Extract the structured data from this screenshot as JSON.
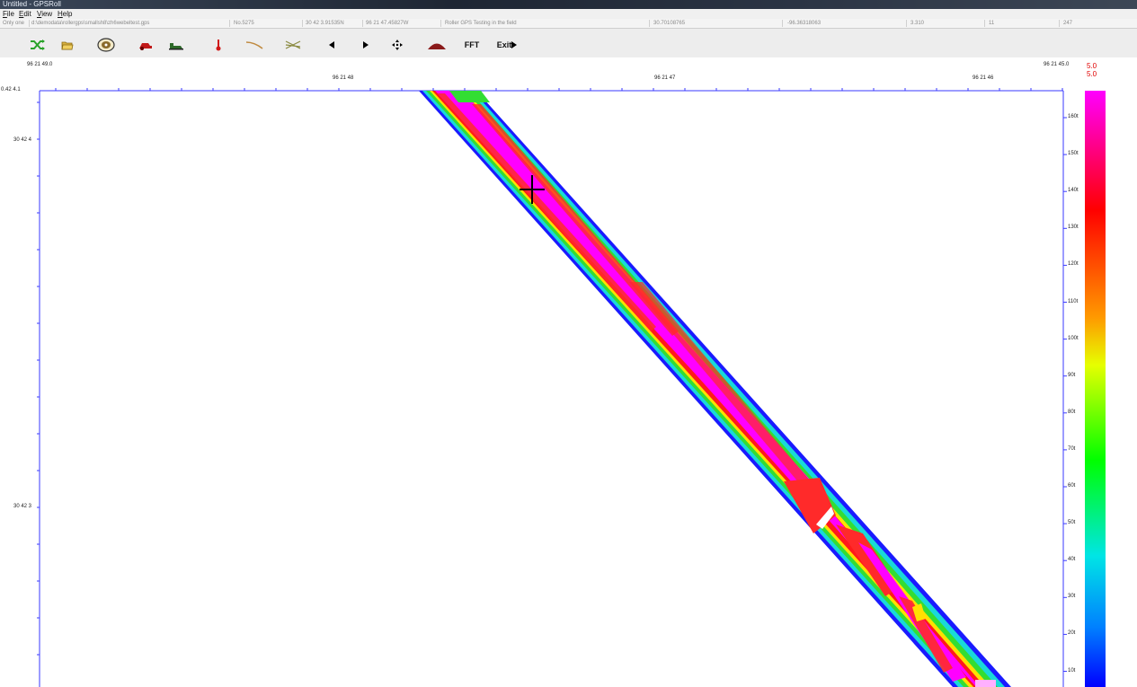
{
  "window": {
    "title": "Untitled - GPSRoll"
  },
  "menu": [
    "File",
    "Edit",
    "View",
    "Help"
  ],
  "status": {
    "mode": "Only one",
    "file_path": "d:\\demodata\\rollergps\\smallsh8\\zh6webeltest.gps",
    "record": "No.5275",
    "latitude": "30 42  3.91535N",
    "longitude": "96 21 47.45827W",
    "description": "Roller GPS Testing in the field",
    "lat_decimal": "30.70108765",
    "lon_decimal": "-96.36318063",
    "value1": "3.310",
    "value2": "11",
    "value3": "247"
  },
  "toolbar": [
    {
      "name": "shuffle-icon",
      "color": "#2aa32a"
    },
    {
      "name": "open-folder-icon",
      "color": "#caa23a"
    },
    {
      "name": "disc-icon",
      "color": "#6b5a2a"
    },
    {
      "name": "roller-red-icon",
      "color": "#c01818"
    },
    {
      "name": "roller-green-icon",
      "color": "#2e6a2a"
    },
    {
      "name": "thermometer-icon",
      "color": "#d01818"
    },
    {
      "name": "curve-icon",
      "color": "#c08a40"
    },
    {
      "name": "crossing-lines-icon",
      "color": "#8a8a40"
    },
    {
      "name": "left-arrow-icon",
      "color": "#000000"
    },
    {
      "name": "right-arrow-icon",
      "color": "#000000"
    },
    {
      "name": "move-icon",
      "color": "#000000"
    },
    {
      "name": "mound-icon",
      "color": "#8a1a1a"
    }
  ],
  "toolbar_text": {
    "fft": "FFT",
    "exit": "Exit"
  },
  "axes": {
    "top_labels": [
      "96 21 49.0",
      "96 21 48",
      "96 21 47",
      "96 21 46",
      "96 21 45.0"
    ],
    "left_labels": [
      "0.42  4.1",
      "30 42  4",
      "30 42  3"
    ],
    "colorbar_labels": [
      "160t",
      "150t",
      "140t",
      "130t",
      "120t",
      "110t",
      "100t",
      "90t",
      "80t",
      "70t",
      "60t",
      "50t",
      "40t",
      "30t",
      "20t",
      "10t"
    ],
    "colorbar_max_top": "5.0",
    "colorbar_max_bottom": "5.0"
  },
  "colors": {
    "magenta": "#ff00ff",
    "red": "#ff1a1a",
    "yellow": "#ffe000",
    "green": "#33dd33",
    "cyan": "#19d9d9",
    "blue": "#1a1aff",
    "axis": "#3a3aff"
  }
}
